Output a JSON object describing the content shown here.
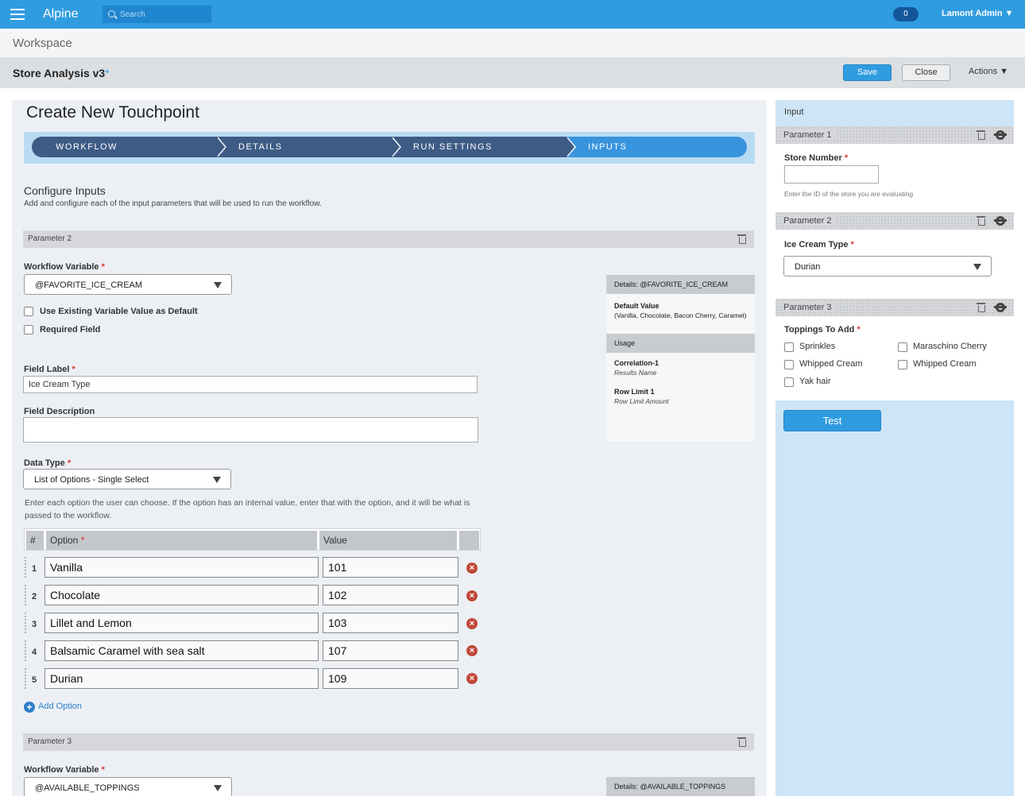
{
  "header": {
    "brand": "Alpine",
    "search_placeholder": "Search",
    "notification_count": "0",
    "user_menu": "Lamont Admin ▼"
  },
  "workspace": {
    "title": "Workspace"
  },
  "document": {
    "title": "Store Analysis v3",
    "unsaved_marker": "*",
    "save_label": "Save",
    "close_label": "Close",
    "actions_label": "Actions ▼"
  },
  "main": {
    "title": "Create New Touchpoint",
    "steps": [
      "WORKFLOW",
      "DETAILS",
      "RUN SETTINGS",
      "INPUTS"
    ],
    "active_step": "INPUTS",
    "section_title": "Configure Inputs",
    "section_desc": "Add and configure each of the input parameters that will be used to run the workflow.",
    "param2": {
      "header": "Parameter 2",
      "workflow_variable_label": "Workflow Variable",
      "workflow_variable_value": "@FAVORITE_ICE_CREAM",
      "use_existing_label": "Use Existing Variable Value as Default",
      "required_label": "Required Field",
      "field_label_label": "Field Label",
      "field_label_value": "Ice Cream Type",
      "field_desc_label": "Field Description",
      "field_desc_value": "",
      "data_type_label": "Data Type",
      "data_type_value": "List of Options - Single Select",
      "options_hint": "Enter each option the user can choose. If the option has an internal value, enter that with the option, and it will be what is passed to the workflow.",
      "table_headers": {
        "num": "#",
        "option": "Option",
        "value": "Value"
      },
      "options": [
        {
          "n": "1",
          "option": "Vanilla",
          "value": "101"
        },
        {
          "n": "2",
          "option": "Chocolate",
          "value": "102"
        },
        {
          "n": "3",
          "option": "Lillet and Lemon",
          "value": "103"
        },
        {
          "n": "4",
          "option": "Balsamic Caramel with sea salt",
          "value": "107"
        },
        {
          "n": "5",
          "option": "Durian",
          "value": "109"
        }
      ],
      "add_option_label": "Add Option",
      "details": {
        "header": "Details: @FAVORITE_ICE_CREAM",
        "default_value_label": "Default Value",
        "default_value": "(Vanilla, Chocolate, Bacon Cherry, Caramel)",
        "usage_header": "Usage",
        "usage": [
          {
            "name": "Correlation-1",
            "sub": "Results Name"
          },
          {
            "name": "Row Limit 1",
            "sub": "Row Limit Amount"
          }
        ]
      }
    },
    "param3": {
      "header": "Parameter 3",
      "workflow_variable_label": "Workflow Variable",
      "workflow_variable_value": "@AVAILABLE_TOPPINGS",
      "details_header": "Details: @AVAILABLE_TOPPINGS"
    }
  },
  "side": {
    "title": "Input",
    "p1": {
      "header": "Parameter 1",
      "label": "Store Number",
      "value": "",
      "hint": "Enter the ID of the store you are evaluating"
    },
    "p2": {
      "header": "Parameter 2",
      "label": "Ice Cream Type",
      "value": "Durian"
    },
    "p3": {
      "header": "Parameter 3",
      "label": "Toppings To Add",
      "options": [
        "Sprinkles",
        "Maraschino Cherry",
        "Whipped Cream",
        "Whipped Cream",
        "Yak hair"
      ]
    },
    "test_label": "Test"
  },
  "colors": {
    "topbar": "#2f9ce0",
    "wizard_step": "#3e5b85",
    "wizard_active": "#3894dd",
    "side_panel": "#cde5f7",
    "required": "#dd3333",
    "delete": "#c0493a"
  }
}
